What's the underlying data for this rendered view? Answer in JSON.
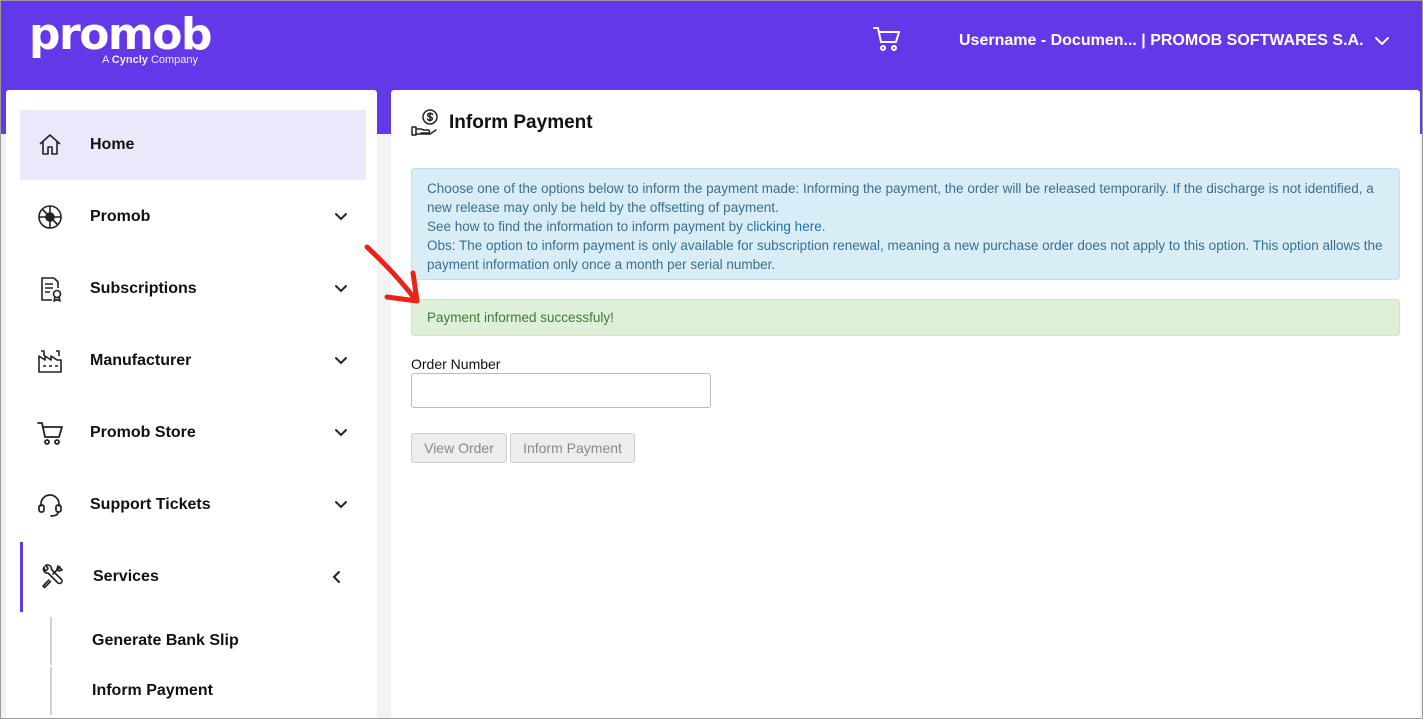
{
  "header": {
    "logo_text": "promob",
    "logo_tagline_prefix": "A",
    "logo_tagline_brand": "Cyncly",
    "logo_tagline_suffix": "Company",
    "user_label": "Username - Documen... | PROMOB SOFTWARES S.A."
  },
  "sidebar": {
    "items": [
      {
        "label": "Home",
        "icon": "home-icon"
      },
      {
        "label": "Promob",
        "icon": "promob-icon"
      },
      {
        "label": "Subscriptions",
        "icon": "subscription-icon"
      },
      {
        "label": "Manufacturer",
        "icon": "factory-icon"
      },
      {
        "label": "Promob Store",
        "icon": "cart-icon"
      },
      {
        "label": "Support Tickets",
        "icon": "headset-icon"
      },
      {
        "label": "Services",
        "icon": "tools-icon"
      }
    ],
    "sub_items": [
      {
        "label": "Generate Bank Slip"
      },
      {
        "label": "Inform Payment"
      }
    ]
  },
  "main": {
    "title": "Inform Payment",
    "info": {
      "line1": "Choose one of the options below to inform the payment made: Informing the payment, the order will be released temporarily. If the discharge is not identified, a new release may only be held by the offsetting of payment.",
      "line2_prefix": "See how to find the information to inform payment by ",
      "line2_link": "clicking here",
      "line2_suffix": ".",
      "line3": "Obs: The option to inform payment is only available for subscription renewal, meaning a new purchase order does not apply to this option. This option allows the payment information only once a month per serial number."
    },
    "success_message": "Payment informed successfuly!",
    "order_label": "Order Number",
    "order_value": "",
    "view_order_button": "View Order",
    "inform_payment_button": "Inform Payment"
  },
  "colors": {
    "brand": "#6338e8",
    "info_bg": "#d9edf6",
    "success_bg": "#dff0d8",
    "annotation_arrow": "#e8231a"
  }
}
